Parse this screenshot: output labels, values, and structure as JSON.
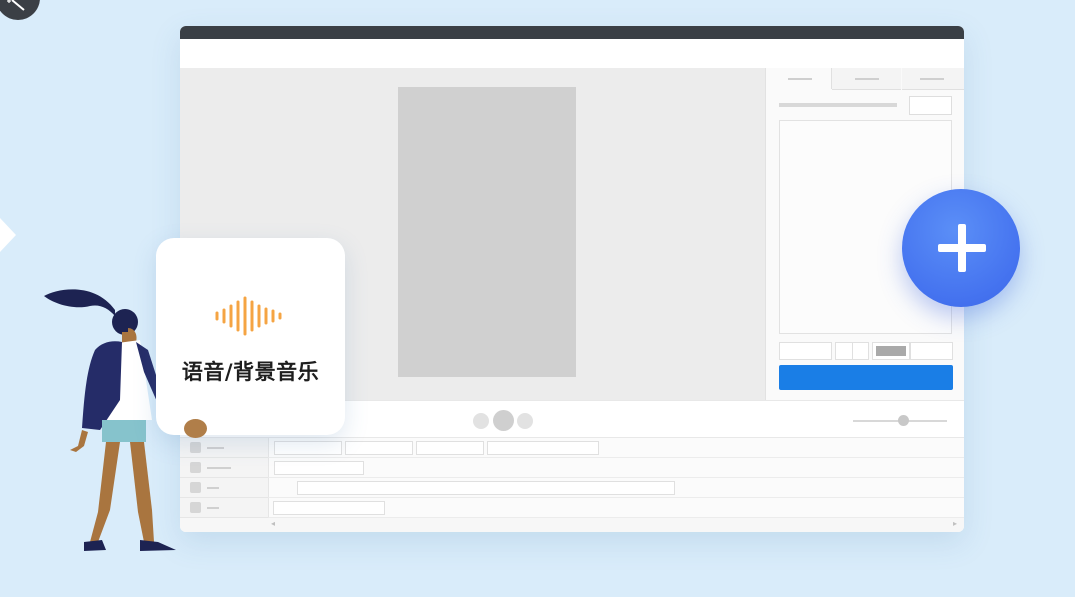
{
  "feature_card": {
    "label": "语音/背景音乐",
    "icon": "audio-waveform-icon",
    "accent_color": "#f5a443"
  },
  "add_button": {
    "icon": "plus-icon",
    "color": "#4472ef"
  },
  "editor": {
    "titlebar_color": "#3a3f45",
    "apply_button_color": "#1a7ee6",
    "panel_tabs": [
      "tab-1",
      "tab-2",
      "tab-3"
    ],
    "timeline_tracks": [
      "track-1",
      "track-2",
      "track-3",
      "track-4"
    ]
  },
  "corner_tool": {
    "icon": "magic-wand-icon"
  }
}
